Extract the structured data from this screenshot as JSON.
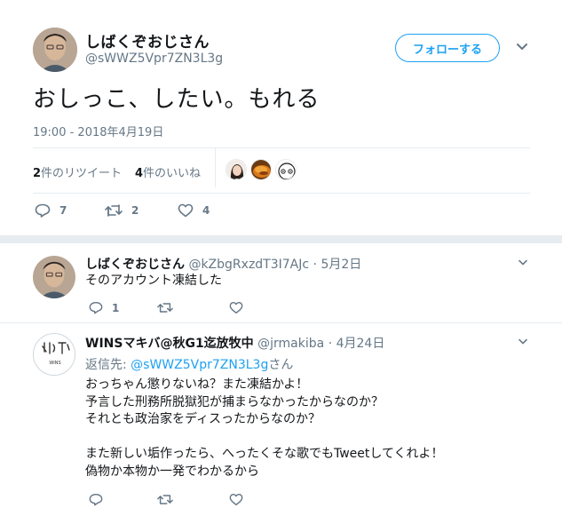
{
  "main_tweet": {
    "display_name": "しばくぞおじさん",
    "handle": "@sWWZ5Vpr7ZN3L3g",
    "follow_label": "フォローする",
    "text": "おしっこ、したい。もれる",
    "timestamp": "19:00 - 2018年4月19日",
    "retweets": {
      "count": "2",
      "label": "件のリツイート"
    },
    "likes": {
      "count": "4",
      "label": "件のいいね"
    },
    "actions": {
      "reply_count": "7",
      "retweet_count": "2",
      "like_count": "4"
    },
    "liker_avatars": [
      "girl-avatar",
      "food-avatar",
      "cartoon-avatar"
    ]
  },
  "replies": [
    {
      "display_name": "しばくぞおじさん",
      "handle": "@kZbgRxzdT3I7AJc",
      "separator": "·",
      "date": "5月2日",
      "text": "そのアカウント凍結した",
      "reply_count": "1",
      "retweet_count": "",
      "like_count": ""
    },
    {
      "display_name": "WINSマキバ@秋G1迄放牧中",
      "handle": "@jrmakiba",
      "separator": "·",
      "date": "4月24日",
      "reply_to_label": "返信先:",
      "reply_to_handle": "@sWWZ5Vpr7ZN3L3g",
      "reply_to_suffix": "さん",
      "text": "おっちゃん懲りないね？また凍結かよ！\n予言した刑務所脱獄犯が捕まらなかったからなのか？\nそれとも政治家をディスったからなのか？\n\nまた新しい垢作ったら、へったくそな歌でもTweetしてくれよ！\n偽物か本物か一発でわかるから",
      "reply_count": "",
      "retweet_count": "",
      "like_count": ""
    }
  ],
  "colors": {
    "accent": "#1da1f2",
    "text": "#14171a",
    "secondary": "#657786",
    "divider": "#e6ecf0"
  }
}
